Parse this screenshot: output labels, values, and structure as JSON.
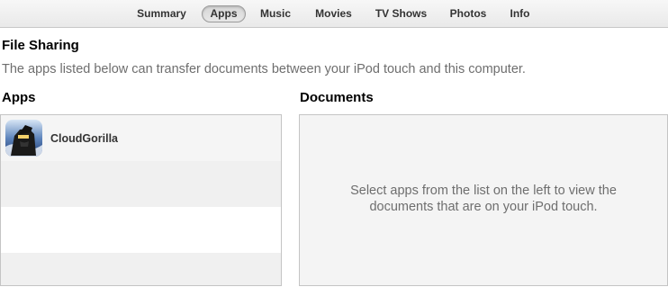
{
  "tabs": [
    {
      "label": "Summary",
      "active": false
    },
    {
      "label": "Apps",
      "active": true
    },
    {
      "label": "Music",
      "active": false
    },
    {
      "label": "Movies",
      "active": false
    },
    {
      "label": "TV Shows",
      "active": false
    },
    {
      "label": "Photos",
      "active": false
    },
    {
      "label": "Info",
      "active": false
    }
  ],
  "file_sharing": {
    "title": "File Sharing",
    "description": "The apps listed below can transfer documents between your iPod touch and this computer."
  },
  "apps": {
    "header": "Apps",
    "items": [
      {
        "name": "CloudGorilla",
        "icon": "cloudgorilla-app-icon"
      }
    ]
  },
  "documents": {
    "header": "Documents",
    "empty_message": "Select apps from the list on the left to view the documents that are on your iPod touch."
  }
}
